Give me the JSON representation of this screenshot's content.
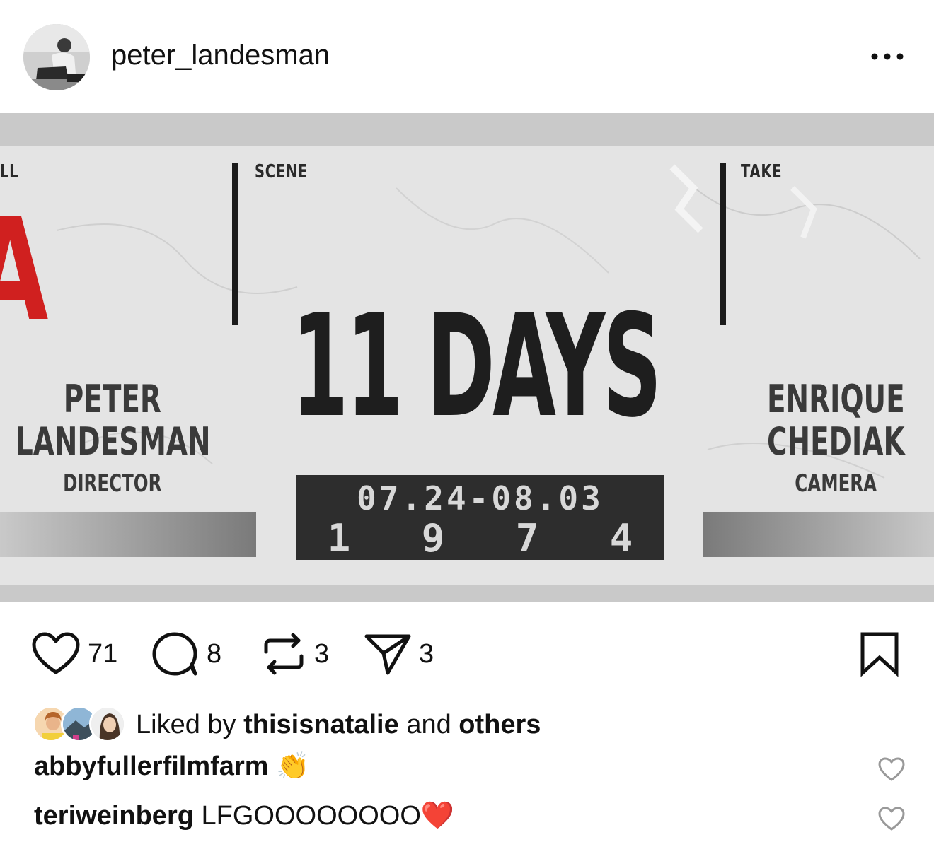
{
  "post": {
    "username": "peter_landesman",
    "more_icon": "ellipsis-icon"
  },
  "image": {
    "label_left": "LL",
    "label_scene": "SCENE",
    "label_take": "TAKE",
    "red_letter": "A",
    "left_name_line1": "PETER",
    "left_name_line2": "LANDESMAN",
    "left_role": "DIRECTOR",
    "title": "11 DAYS",
    "date_line1": "07.24-08.03",
    "date_line2": "1 9 7 4",
    "right_name_line1": "ENRIQUE",
    "right_name_line2": "CHEDIAK",
    "right_role": "CAMERA"
  },
  "actions": {
    "likes": "71",
    "comments": "8",
    "reposts": "3",
    "shares": "3"
  },
  "liked_by": {
    "prefix": "Liked by",
    "user": "thisisnatalie",
    "middle": "and",
    "suffix": "others"
  },
  "comments": [
    {
      "user": "abbyfullerfilmfarm",
      "text": "👏"
    },
    {
      "user": "teriweinberg",
      "text": "LFGOOOOOOOO❤️"
    }
  ]
}
